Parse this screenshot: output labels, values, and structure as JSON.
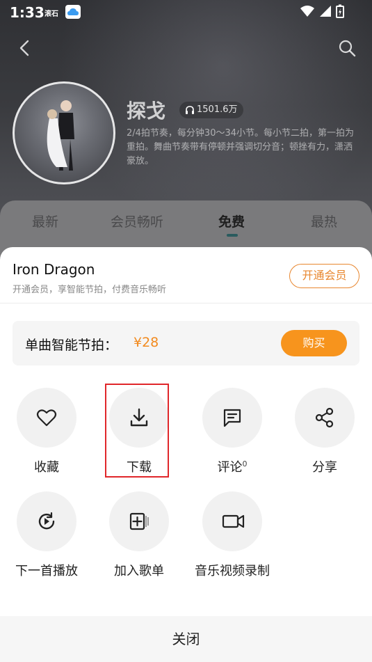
{
  "status_bar": {
    "time": "1:33",
    "app_badge": "滚石"
  },
  "header": {
    "title": "探戈",
    "play_count": "1501.6万",
    "description": "2/4拍节奏，每分钟30〜34小节。每小节二拍，第一拍为重拍。舞曲节奏带有停顿并强调切分音；顿挫有力，潇洒豪放。"
  },
  "tabs": [
    {
      "label": "最新"
    },
    {
      "label": "会员畅听"
    },
    {
      "label": "免费"
    },
    {
      "label": "最热"
    }
  ],
  "sheet": {
    "song_name": "Iron Dragon",
    "subtitle": "开通会员，享智能节拍，付费音乐畅听",
    "vip_button": "开通会员",
    "buy": {
      "label": "单曲智能节拍：",
      "price": "¥28",
      "button": "购买"
    },
    "actions": [
      {
        "label": "收藏",
        "icon": "heart-icon"
      },
      {
        "label": "下载",
        "icon": "download-icon"
      },
      {
        "label": "评论",
        "count": "0",
        "icon": "comment-icon"
      },
      {
        "label": "分享",
        "icon": "share-icon"
      },
      {
        "label": "下一首播放",
        "icon": "play-next-icon"
      },
      {
        "label": "加入歌单",
        "icon": "add-playlist-icon"
      },
      {
        "label": "音乐视频录制",
        "icon": "video-record-icon"
      }
    ],
    "close_label": "关闭"
  },
  "colors": {
    "accent": "#f7941d",
    "vip_border": "#e8862e",
    "highlight": "#e0262a"
  }
}
